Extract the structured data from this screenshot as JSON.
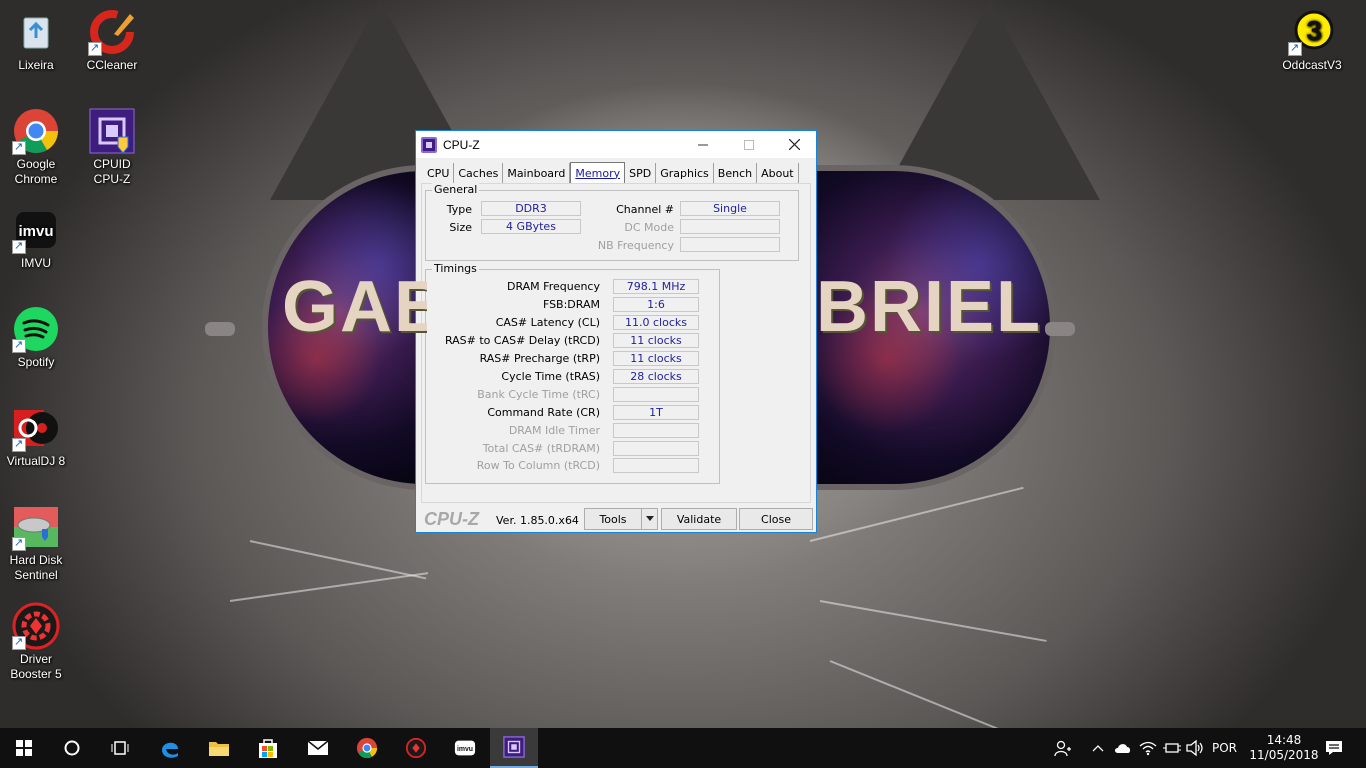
{
  "desktop": {
    "icons_left": [
      {
        "label_lines": [
          "Lixeira"
        ],
        "icon": "recycle-bin-icon"
      },
      {
        "label_lines": [
          "Google",
          "Chrome"
        ],
        "icon": "chrome-icon"
      },
      {
        "label_lines": [
          "IMVU"
        ],
        "icon": "imvu-icon"
      },
      {
        "label_lines": [
          "Spotify"
        ],
        "icon": "spotify-icon"
      },
      {
        "label_lines": [
          "VirtualDJ 8"
        ],
        "icon": "virtualdj-icon"
      },
      {
        "label_lines": [
          "Hard Disk",
          "Sentinel"
        ],
        "icon": "hard-disk-sentinel-icon"
      },
      {
        "label_lines": [
          "Driver",
          "Booster 5"
        ],
        "icon": "driver-booster-icon"
      }
    ],
    "icons_col2": [
      {
        "label_lines": [
          "CCleaner"
        ],
        "icon": "ccleaner-icon"
      },
      {
        "label_lines": [
          "CPUID",
          "CPU-Z"
        ],
        "icon": "cpuz-icon"
      }
    ],
    "icon_right": {
      "label_lines": [
        "OddcastV3"
      ],
      "icon": "oddcast-icon"
    },
    "wallpaper_text": {
      "left": "GAB",
      "right": "BRIEL"
    }
  },
  "window": {
    "title": "CPU-Z",
    "tabs": [
      "CPU",
      "Caches",
      "Mainboard",
      "Memory",
      "SPD",
      "Graphics",
      "Bench",
      "About"
    ],
    "active_tab": "Memory",
    "general": {
      "group_label": "General",
      "type_label": "Type",
      "type_value": "DDR3",
      "size_label": "Size",
      "size_value": "4 GBytes",
      "channel_label": "Channel #",
      "channel_value": "Single",
      "dc_mode_label": "DC Mode",
      "dc_mode_value": "",
      "nb_freq_label": "NB Frequency",
      "nb_freq_value": ""
    },
    "timings": {
      "group_label": "Timings",
      "rows": [
        {
          "label": "DRAM Frequency",
          "value": "798.1 MHz",
          "enabled": true
        },
        {
          "label": "FSB:DRAM",
          "value": "1:6",
          "enabled": true
        },
        {
          "label": "CAS# Latency (CL)",
          "value": "11.0 clocks",
          "enabled": true
        },
        {
          "label": "RAS# to CAS# Delay (tRCD)",
          "value": "11 clocks",
          "enabled": true
        },
        {
          "label": "RAS# Precharge (tRP)",
          "value": "11 clocks",
          "enabled": true
        },
        {
          "label": "Cycle Time (tRAS)",
          "value": "28 clocks",
          "enabled": true
        },
        {
          "label": "Bank Cycle Time (tRC)",
          "value": "",
          "enabled": false
        },
        {
          "label": "Command Rate (CR)",
          "value": "1T",
          "enabled": true
        },
        {
          "label": "DRAM Idle Timer",
          "value": "",
          "enabled": false
        },
        {
          "label": "Total CAS# (tRDRAM)",
          "value": "",
          "enabled": false
        },
        {
          "label": "Row To Column (tRCD)",
          "value": "",
          "enabled": false
        }
      ]
    },
    "footer": {
      "brand": "CPU-Z",
      "version": "Ver. 1.85.0.x64",
      "tools_label": "Tools",
      "validate_label": "Validate",
      "close_label": "Close"
    }
  },
  "taskbar": {
    "apps": [
      "start-icon",
      "search-circle-icon",
      "task-view-icon",
      "edge-icon",
      "file-explorer-icon",
      "store-icon",
      "mail-icon",
      "chrome-icon",
      "driver-booster-icon",
      "imvu-icon",
      "cpuz-icon"
    ],
    "active_app": "cpuz-icon",
    "tray": {
      "language": "POR",
      "time": "14:48",
      "date": "11/05/2018"
    }
  },
  "colors": {
    "accent": "#1883d7",
    "value_text": "#1f1f9a",
    "taskbar_bg": "#101010"
  }
}
